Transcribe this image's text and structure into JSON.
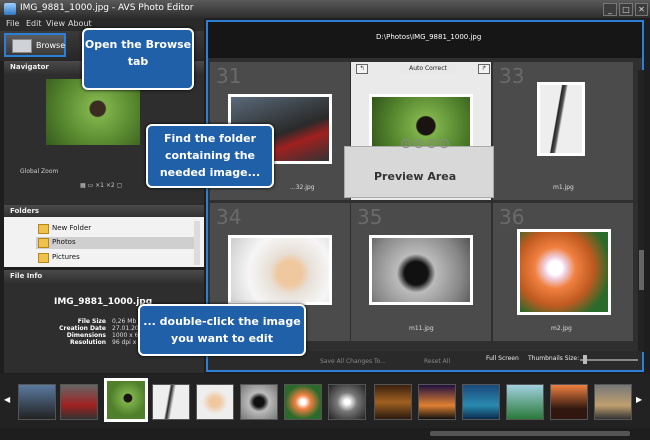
{
  "window": {
    "title": "IMG_9881_1000.jpg - AVS Photo Editor",
    "min": "_",
    "max": "□",
    "close": "✕"
  },
  "menu": {
    "items": [
      "File",
      "Edit",
      "View",
      "About"
    ]
  },
  "toolbar": {
    "browse_label": "Browse"
  },
  "navigator": {
    "title": "Navigator",
    "zoom_label": "Global Zoom",
    "zoom_controls": "▦  ▭  ×1  ×2  ▢"
  },
  "folders": {
    "title": "Folders",
    "items": [
      "New Folder",
      "Photos",
      "Pictures"
    ],
    "selected": "Photos"
  },
  "file_info": {
    "title": "File Info",
    "filename": "IMG_9881_1000.jpg",
    "fields": [
      {
        "key": "File Size",
        "value": "0,26 Mb"
      },
      {
        "key": "Creation Date",
        "value": "27.01.2010"
      },
      {
        "key": "Dimensions",
        "value": "1000 x 667"
      },
      {
        "key": "Resolution",
        "value": "96 dpi x 96"
      }
    ]
  },
  "preview": {
    "path": "D:\\Photos\\IMG_9881_1000.jpg",
    "auto_correct_label": "Auto Correct",
    "card_label": "Preview Area",
    "cells": [
      {
        "num": "31",
        "caption": "...32.jpg"
      },
      {
        "num": "32",
        "caption": ""
      },
      {
        "num": "33",
        "caption": "m1.jpg"
      },
      {
        "num": "34",
        "caption": ""
      },
      {
        "num": "35",
        "caption": "m11.jpg"
      },
      {
        "num": "36",
        "caption": "m2.jpg"
      }
    ],
    "bottom": {
      "save_all": "Save All Changes To...",
      "reset_all": "Reset All",
      "full_screen": "Full Screen",
      "thumb_size": "Thumbnails Size:"
    }
  },
  "callouts": {
    "browse": "Open the Browse tab",
    "find_folder": "Find the folder containing the needed image...",
    "double_click": "... double-click the image you want to edit"
  },
  "colors": {
    "accent": "#2b7fd6",
    "callout_bg": "#2060a8"
  }
}
